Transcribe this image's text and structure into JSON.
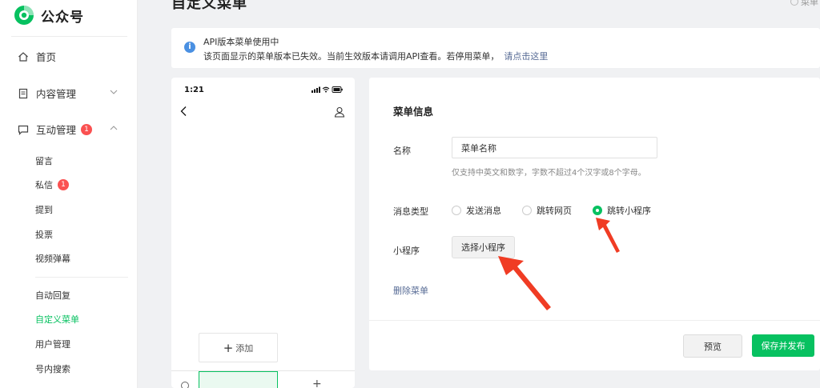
{
  "brand": {
    "name": "公众号",
    "accent": "#07c160"
  },
  "page": {
    "title": "自定义菜单",
    "top_right": "菜单"
  },
  "sidebar": {
    "home": "首页",
    "content": "内容管理",
    "interaction": {
      "label": "互动管理",
      "badge": "1"
    },
    "sub_items": [
      {
        "label": "留言"
      },
      {
        "label": "私信",
        "badge": "1"
      },
      {
        "label": "提到"
      },
      {
        "label": "投票"
      },
      {
        "label": "视频弹幕"
      },
      {
        "label": "自动回复"
      },
      {
        "label": "自定义菜单"
      },
      {
        "label": "用户管理"
      },
      {
        "label": "号内搜索"
      }
    ]
  },
  "notice": {
    "line1": "API版本菜单使用中",
    "line2": "该页面显示的菜单版本已失效。当前生效版本请调用API查看。若停用菜单，",
    "link": "请点击这里"
  },
  "phone": {
    "time": "1:21",
    "add_label": "添加"
  },
  "editor": {
    "section_title": "菜单信息",
    "name_label": "名称",
    "name_value": "菜单名称",
    "name_hint": "仅支持中英文和数字，字数不超过4个汉字或8个字母。",
    "msg_type_label": "消息类型",
    "options": [
      "发送消息",
      "跳转网页",
      "跳转小程序"
    ],
    "selected_option": "跳转小程序",
    "mini_label": "小程序",
    "choose_button": "选择小程序",
    "delete_link": "删除菜单",
    "preview_button": "预览",
    "publish_button": "保存并发布"
  },
  "annotations": {
    "arrow_color": "#f03c24"
  }
}
